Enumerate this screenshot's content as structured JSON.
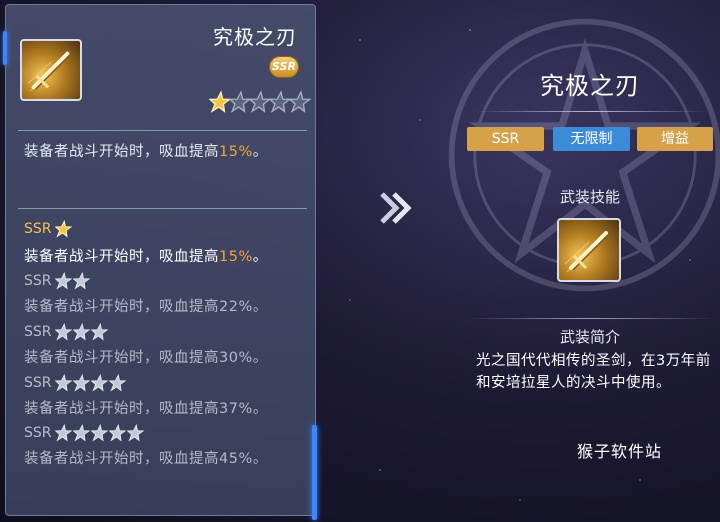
{
  "item": {
    "title": "究极之刃",
    "rarity": "SSR",
    "star_level": 1,
    "star_max": 5,
    "effect_prefix": "装备者战斗开始时，吸血提高",
    "effect_value": "15%",
    "effect_suffix": "。"
  },
  "levels": [
    {
      "label": "SSR",
      "stars": 1,
      "prefix": "装备者战斗开始时，吸血提高",
      "value": "15%",
      "suffix": "。",
      "active": true
    },
    {
      "label": "SSR",
      "stars": 2,
      "prefix": "装备者战斗开始时，吸血提高",
      "value": "22%",
      "suffix": "。",
      "active": false
    },
    {
      "label": "SSR",
      "stars": 3,
      "prefix": "装备者战斗开始时，吸血提高",
      "value": "30%",
      "suffix": "。",
      "active": false
    },
    {
      "label": "SSR",
      "stars": 4,
      "prefix": "装备者战斗开始时，吸血提高",
      "value": "37%",
      "suffix": "。",
      "active": false
    },
    {
      "label": "SSR",
      "stars": 5,
      "prefix": "装备者战斗开始时，吸血提高",
      "value": "45%",
      "suffix": "。",
      "active": false
    }
  ],
  "detail": {
    "title": "究极之刃",
    "tags": [
      "SSR",
      "无限制",
      "增益"
    ],
    "skill_label": "武装技能",
    "intro_label": "武装简介",
    "intro_text": "光之国代代相传的圣剑，在3万年前和安培拉星人的决斗中使用。"
  },
  "watermark": "猴子软件站",
  "icons": {
    "item": "sword-icon",
    "skill": "sword-icon",
    "arrow": "double-chevron-right-icon",
    "star": "star-icon"
  },
  "colors": {
    "highlight": "#f3a33b",
    "ssr_gold": "#d5a24a",
    "unlimited_blue": "#3c8bd9",
    "panel": "#464e6c"
  }
}
